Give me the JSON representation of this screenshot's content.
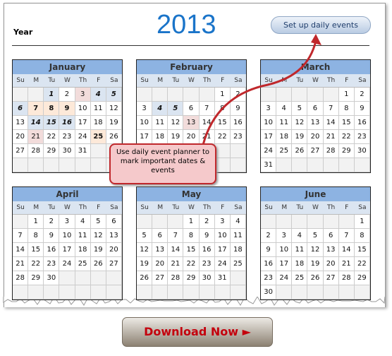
{
  "header": {
    "year_label": "Year",
    "year": "2013",
    "setup_button": "Set up daily events"
  },
  "weekdays": [
    "Su",
    "M",
    "Tu",
    "W",
    "Th",
    "F",
    "Sa"
  ],
  "months": [
    {
      "name": "January",
      "first_weekday": 2,
      "days": 31,
      "highlights": {
        "1": "blue",
        "3": "pink",
        "4": "blue",
        "5": "blue",
        "6": "blue",
        "7": "orange",
        "8": "orange",
        "9": "orange",
        "14": "blue",
        "15": "blue",
        "16": "blue",
        "21": "pink",
        "25": "orange"
      }
    },
    {
      "name": "February",
      "first_weekday": 5,
      "days": 28,
      "highlights": {
        "4": "blue",
        "5": "blue",
        "13": "pink"
      }
    },
    {
      "name": "March",
      "first_weekday": 5,
      "days": 31,
      "highlights": {}
    },
    {
      "name": "April",
      "first_weekday": 1,
      "days": 30,
      "highlights": {}
    },
    {
      "name": "May",
      "first_weekday": 3,
      "days": 31,
      "highlights": {}
    },
    {
      "name": "June",
      "first_weekday": 6,
      "days": 30,
      "highlights": {}
    }
  ],
  "callout": {
    "text": "Use daily event planner to mark important dates & events"
  },
  "download": {
    "label": "Download Now",
    "icon": "play-triangle-icon"
  },
  "colors": {
    "year": "#1a74c9",
    "header": "#8db3e2",
    "arrow": "#c0282c",
    "download_text": "#c4000d"
  }
}
